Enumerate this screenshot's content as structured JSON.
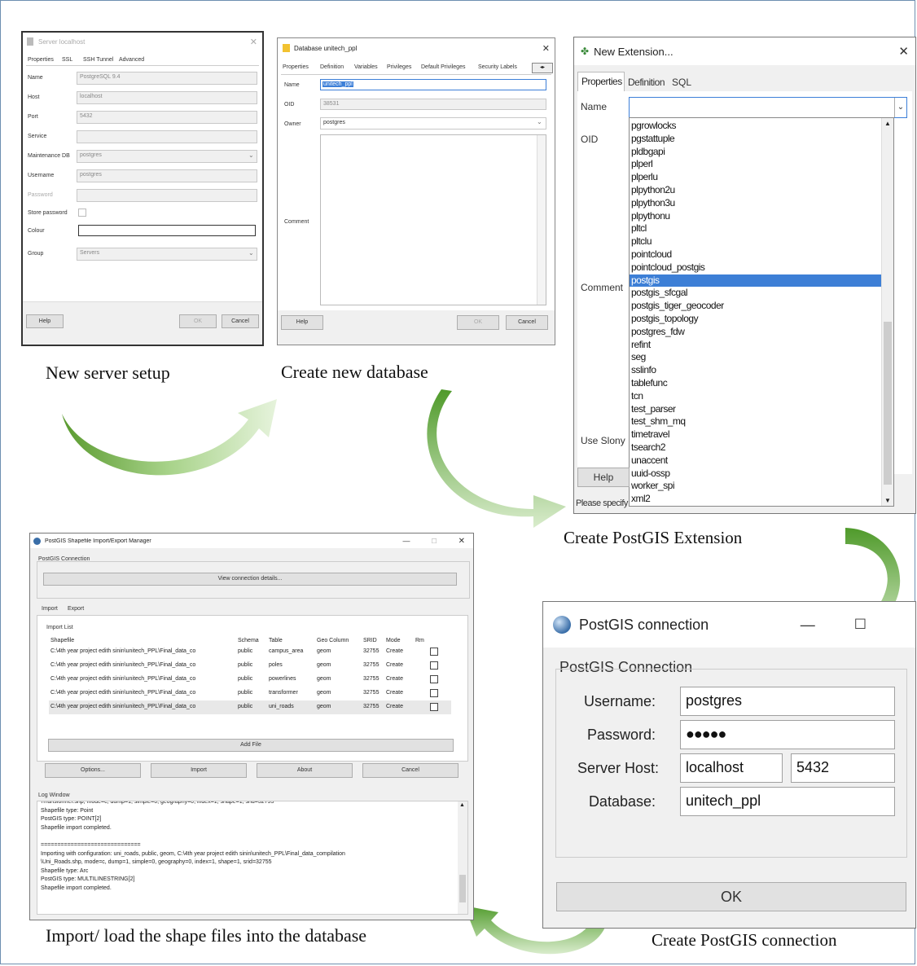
{
  "captions": {
    "server": "New server setup",
    "database": "Create new database",
    "extension": "Create PostGIS Extension",
    "import": "Import/ load the shape files into the database",
    "connection": "Create PostGIS connection"
  },
  "server_dialog": {
    "title": "Server localhost",
    "tabs": [
      "Properties",
      "SSL",
      "SSH Tunnel",
      "Advanced"
    ],
    "fields": [
      {
        "label": "Name",
        "value": "PostgreSQL 9.4"
      },
      {
        "label": "Host",
        "value": "localhost"
      },
      {
        "label": "Port",
        "value": "5432"
      },
      {
        "label": "Service",
        "value": ""
      },
      {
        "label": "Maintenance DB",
        "value": "postgres"
      },
      {
        "label": "Username",
        "value": "postgres"
      },
      {
        "label": "Password",
        "value": ""
      }
    ],
    "store_password_label": "Store password",
    "colour_label": "Colour",
    "group_label": "Group",
    "group_value": "Servers",
    "help": "Help",
    "ok": "OK",
    "cancel": "Cancel"
  },
  "database_dialog": {
    "title": "Database unitech_ppl",
    "tabs": [
      "Properties",
      "Definition",
      "Variables",
      "Privileges",
      "Default Privileges",
      "Security Labels"
    ],
    "name_label": "Name",
    "name_value": "unitech_ppl",
    "oid_label": "OID",
    "oid_value": "38531",
    "owner_label": "Owner",
    "owner_value": "postgres",
    "comment_label": "Comment",
    "help": "Help",
    "ok": "OK",
    "cancel": "Cancel"
  },
  "extension_dialog": {
    "title": "New Extension...",
    "tabs": [
      "Properties",
      "Definition",
      "SQL"
    ],
    "name_label": "Name",
    "oid_label": "OID",
    "comment_label": "Comment",
    "use_slony_label": "Use Slony",
    "help": "Help",
    "status": "Please specify",
    "selected": "postgis",
    "items": [
      "pgrowlocks",
      "pgstattuple",
      "pldbgapi",
      "plperl",
      "plperlu",
      "plpython2u",
      "plpython3u",
      "plpythonu",
      "pltcl",
      "pltclu",
      "pointcloud",
      "pointcloud_postgis",
      "postgis",
      "postgis_sfcgal",
      "postgis_tiger_geocoder",
      "postgis_topology",
      "postgres_fdw",
      "refint",
      "seg",
      "sslinfo",
      "tablefunc",
      "tcn",
      "test_parser",
      "test_shm_mq",
      "timetravel",
      "tsearch2",
      "unaccent",
      "uuid-ossp",
      "worker_spi",
      "xml2"
    ]
  },
  "shapefile_manager": {
    "title": "PostGIS Shapefile Import/Export Manager",
    "connection_group": "PostGIS Connection",
    "view_details": "View connection details...",
    "tabs": [
      "Import",
      "Export"
    ],
    "import_list": "Import List",
    "columns": [
      "Shapefile",
      "Schema",
      "Table",
      "Geo Column",
      "SRID",
      "Mode",
      "Rm"
    ],
    "rows": [
      {
        "file": "C:\\4th year project edith sinin\\unitech_PPL\\Final_data_co",
        "schema": "public",
        "table": "campus_area",
        "geo": "geom",
        "srid": "32755",
        "mode": "Create"
      },
      {
        "file": "C:\\4th year project edith sinin\\unitech_PPL\\Final_data_co",
        "schema": "public",
        "table": "poles",
        "geo": "geom",
        "srid": "32755",
        "mode": "Create"
      },
      {
        "file": "C:\\4th year project edith sinin\\unitech_PPL\\Final_data_co",
        "schema": "public",
        "table": "powerlines",
        "geo": "geom",
        "srid": "32755",
        "mode": "Create"
      },
      {
        "file": "C:\\4th year project edith sinin\\unitech_PPL\\Final_data_co",
        "schema": "public",
        "table": "transformer",
        "geo": "geom",
        "srid": "32755",
        "mode": "Create"
      },
      {
        "file": "C:\\4th year project edith sinin\\unitech_PPL\\Final_data_co",
        "schema": "public",
        "table": "uni_roads",
        "geo": "geom",
        "srid": "32755",
        "mode": "Create"
      }
    ],
    "add_file": "Add File",
    "buttons": [
      "Options...",
      "Import",
      "About",
      "Cancel"
    ],
    "log_title": "Log Window",
    "log_lines": [
      "\\Transformer.shp, mode=c, dump=1, simple=0, geography=0, index=1, shape=1, srid=32755",
      "Shapefile type: Point",
      "PostGIS type: POINT[2]",
      "Shapefile import completed.",
      "",
      "==============================",
      "Importing with configuration: uni_roads, public, geom, C:\\4th year project edith sinin\\unitech_PPL\\Final_data_compilation",
      "\\Uni_Roads.shp, mode=c, dump=1, simple=0, geography=0, index=1, shape=1, srid=32755",
      "Shapefile type: Arc",
      "PostGIS type: MULTILINESTRING[2]",
      "Shapefile import completed."
    ]
  },
  "connection_dialog": {
    "title": "PostGIS connection",
    "group": "PostGIS Connection",
    "username_label": "Username:",
    "username_value": "postgres",
    "password_label": "Password:",
    "password_value": "●●●●●",
    "host_label": "Server Host:",
    "host_value": "localhost",
    "port_value": "5432",
    "database_label": "Database:",
    "database_value": "unitech_ppl",
    "ok": "OK"
  }
}
